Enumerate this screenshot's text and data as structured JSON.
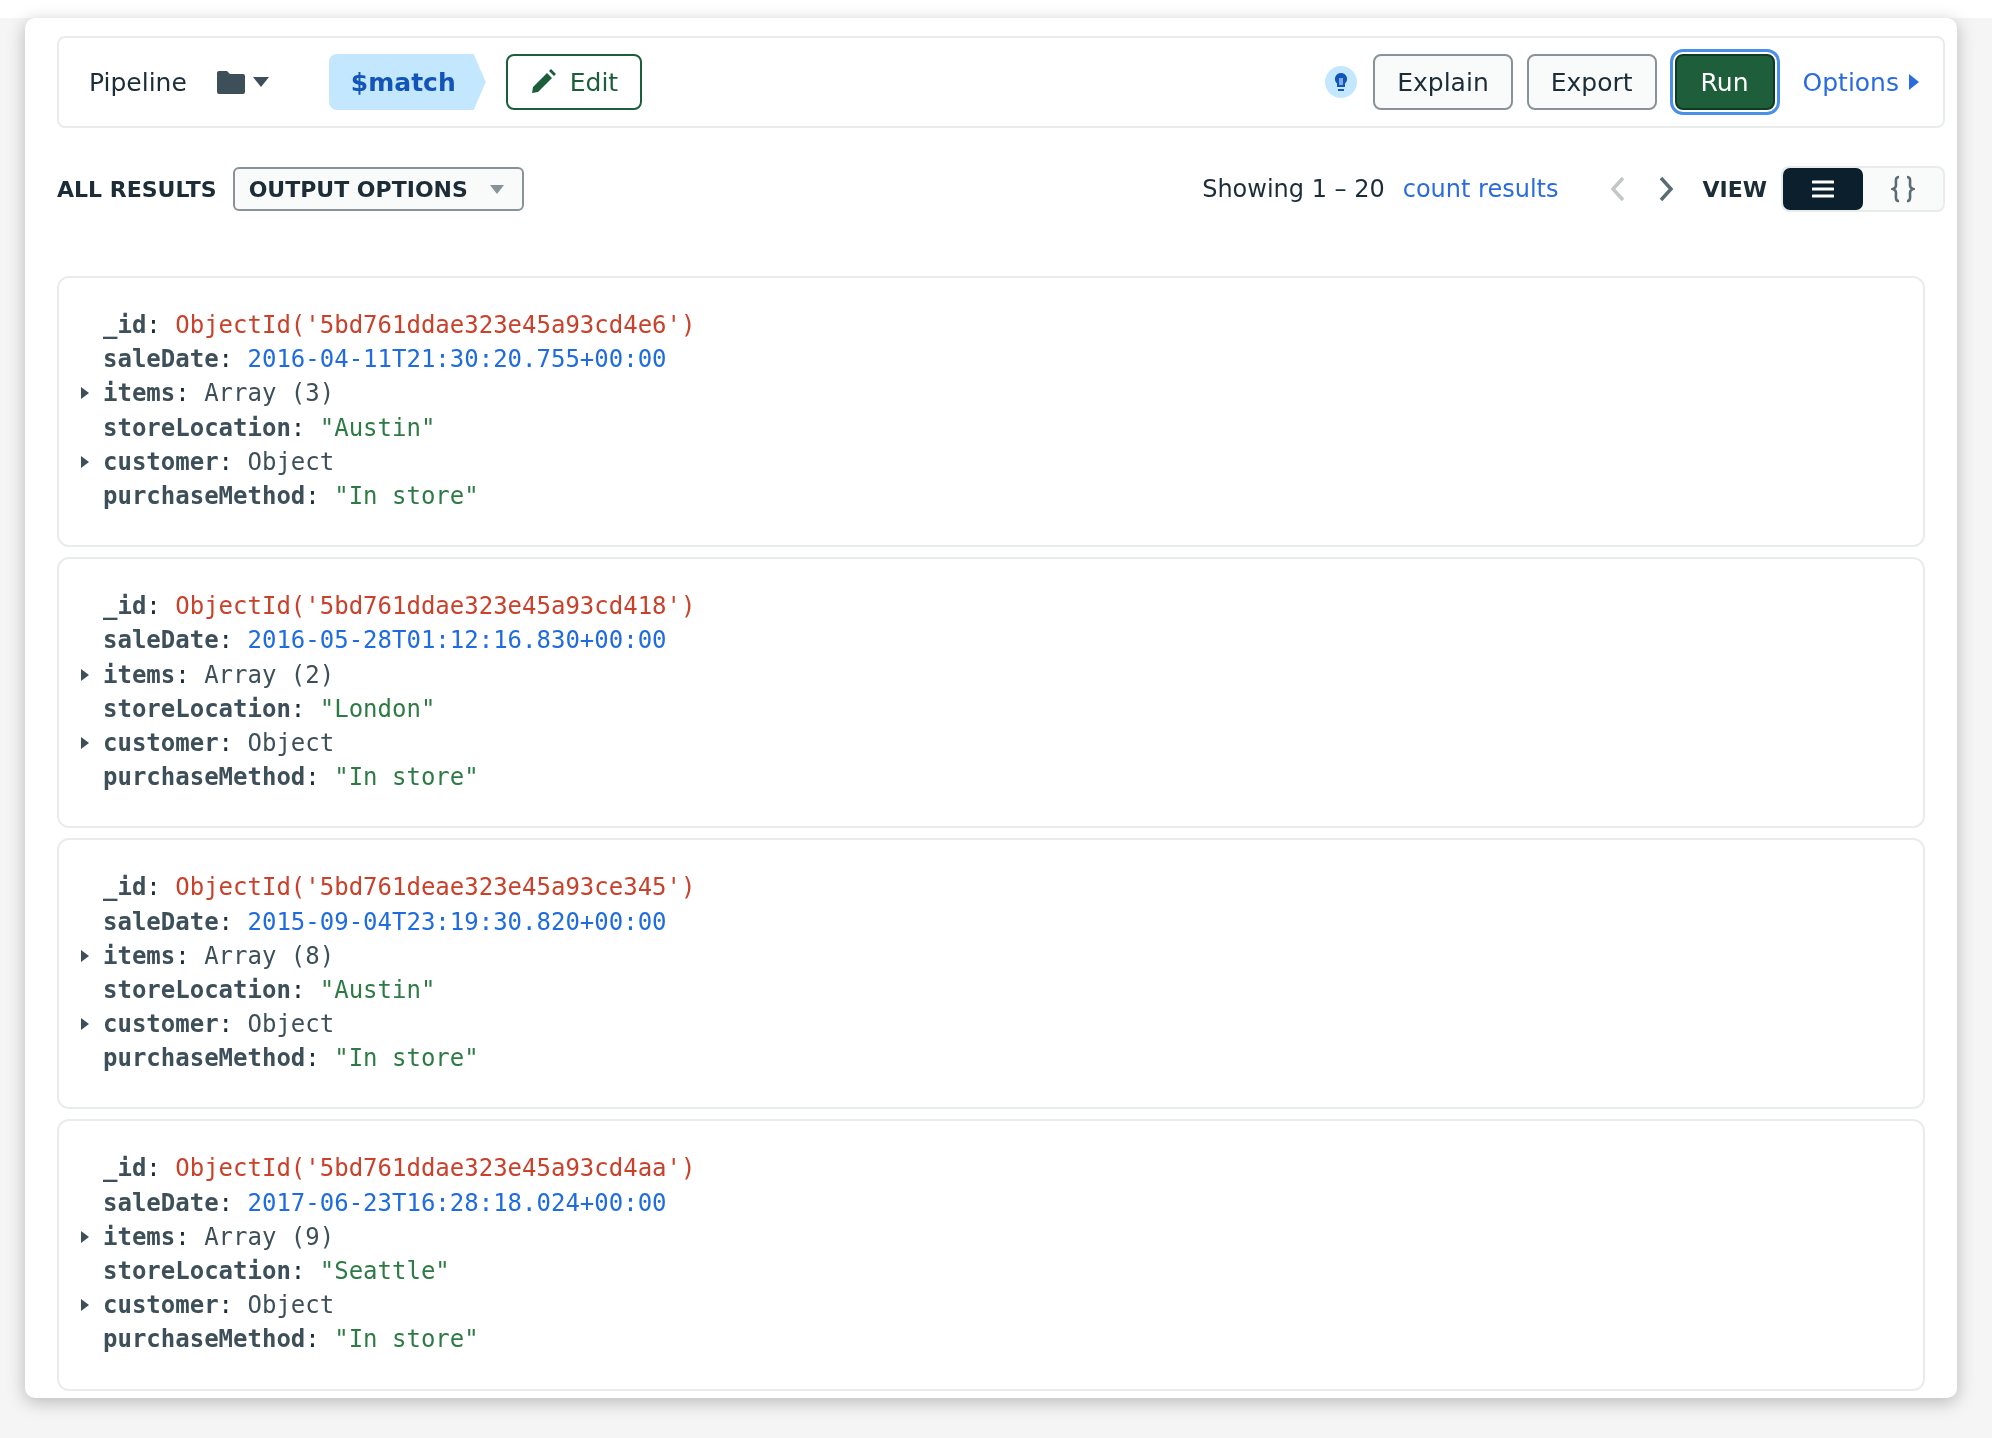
{
  "toolbar": {
    "pipeline_label": "Pipeline",
    "stage": "$match",
    "edit": "Edit",
    "buttons": [
      "Explain",
      "Export"
    ],
    "run": "Run",
    "options": "Options"
  },
  "results": {
    "title": "ALL RESULTS",
    "output_options": "OUTPUT OPTIONS",
    "showing": "Showing 1 – 20",
    "count_link": "count results",
    "pager": [
      {
        "kind": "prev",
        "disabled": true
      },
      {
        "kind": "next",
        "disabled": false
      }
    ],
    "view_label": "VIEW",
    "views": [
      {
        "kind": "list",
        "selected": true
      },
      {
        "kind": "json",
        "selected": false
      }
    ]
  },
  "documents": [
    {
      "fields": [
        {
          "key": "_id:",
          "value": "ObjectId('5bd761ddae323e45a93cd4e6')",
          "kind": "objectid",
          "expandable": false
        },
        {
          "key": "saleDate:",
          "value": "2016-04-11T21:30:20.755+00:00",
          "kind": "date",
          "expandable": false
        },
        {
          "key": "items:",
          "value": "Array (3)",
          "kind": "array",
          "expandable": true
        },
        {
          "key": "storeLocation:",
          "value": "\"Austin\"",
          "kind": "string",
          "expandable": false
        },
        {
          "key": "customer:",
          "value": "Object",
          "kind": "object",
          "expandable": true
        },
        {
          "key": "purchaseMethod:",
          "value": "\"In store\"",
          "kind": "string",
          "expandable": false
        }
      ]
    },
    {
      "fields": [
        {
          "key": "_id:",
          "value": "ObjectId('5bd761ddae323e45a93cd418')",
          "kind": "objectid",
          "expandable": false
        },
        {
          "key": "saleDate:",
          "value": "2016-05-28T01:12:16.830+00:00",
          "kind": "date",
          "expandable": false
        },
        {
          "key": "items:",
          "value": "Array (2)",
          "kind": "array",
          "expandable": true
        },
        {
          "key": "storeLocation:",
          "value": "\"London\"",
          "kind": "string",
          "expandable": false
        },
        {
          "key": "customer:",
          "value": "Object",
          "kind": "object",
          "expandable": true
        },
        {
          "key": "purchaseMethod:",
          "value": "\"In store\"",
          "kind": "string",
          "expandable": false
        }
      ]
    },
    {
      "fields": [
        {
          "key": "_id:",
          "value": "ObjectId('5bd761deae323e45a93ce345')",
          "kind": "objectid",
          "expandable": false
        },
        {
          "key": "saleDate:",
          "value": "2015-09-04T23:19:30.820+00:00",
          "kind": "date",
          "expandable": false
        },
        {
          "key": "items:",
          "value": "Array (8)",
          "kind": "array",
          "expandable": true
        },
        {
          "key": "storeLocation:",
          "value": "\"Austin\"",
          "kind": "string",
          "expandable": false
        },
        {
          "key": "customer:",
          "value": "Object",
          "kind": "object",
          "expandable": true
        },
        {
          "key": "purchaseMethod:",
          "value": "\"In store\"",
          "kind": "string",
          "expandable": false
        }
      ]
    },
    {
      "fields": [
        {
          "key": "_id:",
          "value": "ObjectId('5bd761ddae323e45a93cd4aa')",
          "kind": "objectid",
          "expandable": false
        },
        {
          "key": "saleDate:",
          "value": "2017-06-23T16:28:18.024+00:00",
          "kind": "date",
          "expandable": false
        },
        {
          "key": "items:",
          "value": "Array (9)",
          "kind": "array",
          "expandable": true
        },
        {
          "key": "storeLocation:",
          "value": "\"Seattle\"",
          "kind": "string",
          "expandable": false
        },
        {
          "key": "customer:",
          "value": "Object",
          "kind": "object",
          "expandable": true
        },
        {
          "key": "purchaseMethod:",
          "value": "\"In store\"",
          "kind": "string",
          "expandable": false
        }
      ]
    }
  ]
}
